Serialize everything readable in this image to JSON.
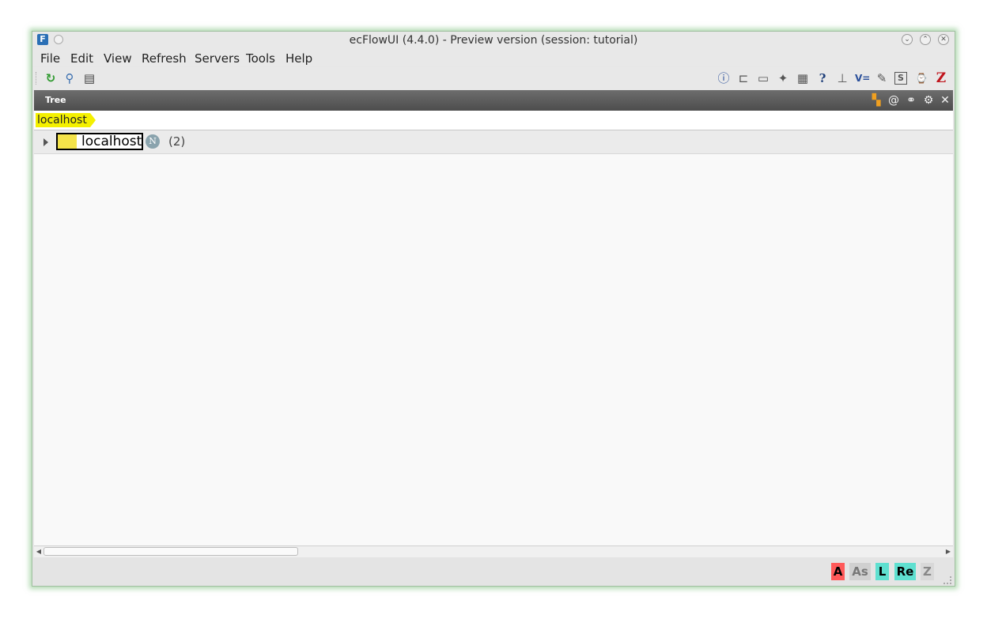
{
  "window": {
    "title": "ecFlowUI (4.4.0)  -  Preview version (session: tutorial)",
    "app_icon_letter": "F"
  },
  "menubar": {
    "items": [
      "File",
      "Edit",
      "View",
      "Refresh",
      "Servers",
      "Tools",
      "Help"
    ]
  },
  "toolbar": {
    "left_icons": [
      "refresh-icon",
      "search-icon",
      "server-icon"
    ],
    "right_icons": [
      "info-icon",
      "book-icon",
      "script-icon",
      "run-icon",
      "output-icon",
      "help-icon",
      "tree-icon",
      "variables-icon",
      "edit-icon",
      "suite-icon",
      "time-icon",
      "zombie-icon"
    ],
    "right_glyphs": [
      "ⓘ",
      "📖",
      "📄",
      "🏃",
      "🖶",
      "?",
      "⊥",
      "V=",
      "✎",
      "S",
      "⌚",
      "Z"
    ]
  },
  "panel": {
    "title": "Tree"
  },
  "breadcrumb": {
    "label": "localhost"
  },
  "tree": {
    "nodes": [
      {
        "label": "localhost",
        "badge": "N",
        "count": "(2)",
        "color": "#f4e34a"
      }
    ]
  },
  "status": {
    "flags": [
      {
        "label": "A",
        "bg": "#ff5a5a",
        "fg": "#000000"
      },
      {
        "label": "As",
        "bg": "#d0d0d0",
        "fg": "#777777"
      },
      {
        "label": "L",
        "bg": "#5fe0d0",
        "fg": "#000000"
      },
      {
        "label": "Re",
        "bg": "#5fe0d0",
        "fg": "#000000"
      },
      {
        "label": "Z",
        "bg": "#d8d8d8",
        "fg": "#888888"
      }
    ]
  }
}
